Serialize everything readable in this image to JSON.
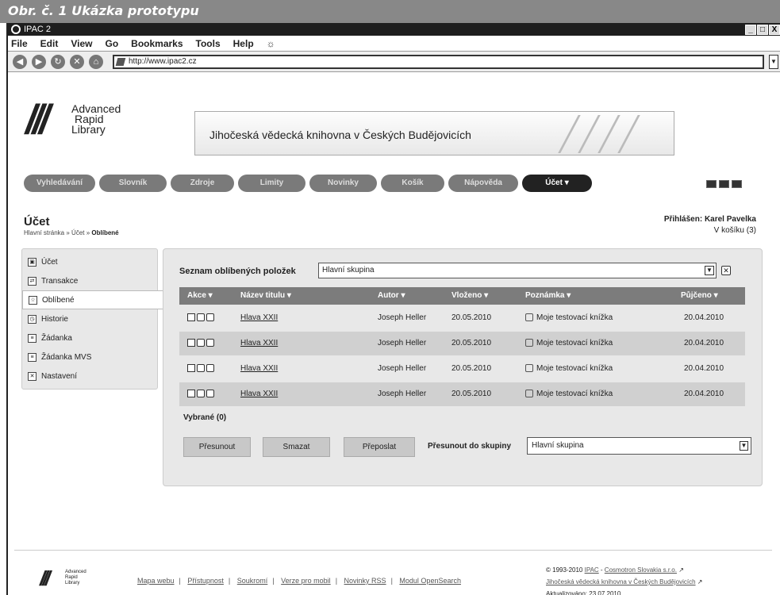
{
  "figure_caption": "Obr. č. 1  Ukázka prototypu",
  "window": {
    "title": "IPAC 2",
    "btn_min": "_",
    "btn_max": "□",
    "btn_close": "X"
  },
  "menubar": [
    "File",
    "Edit",
    "View",
    "Go",
    "Bookmarks",
    "Tools",
    "Help"
  ],
  "address": "http://www.ipac2.cz",
  "logo": {
    "line1": "Advanced",
    "line2": "Rapid",
    "line3": "Library"
  },
  "banner_text": "Jihočeská vědecká knihovna v Českých Budějovicích",
  "tabs": [
    {
      "label": "Vyhledávání",
      "active": false
    },
    {
      "label": "Slovník",
      "active": false
    },
    {
      "label": "Zdroje",
      "active": false
    },
    {
      "label": "Limity",
      "active": false
    },
    {
      "label": "Novinky",
      "active": false
    },
    {
      "label": "Košík",
      "active": false
    },
    {
      "label": "Nápověda",
      "active": false
    },
    {
      "label": "Účet ▾",
      "active": true
    }
  ],
  "heading": "Účet",
  "breadcrumb": {
    "home": "Hlavní stránka",
    "sep": " » ",
    "level2": "Účet",
    "current": "Oblíbené"
  },
  "login": {
    "text": "Přihlášen: Karel Pavelka",
    "basket": "V košíku (3)"
  },
  "sidebar": [
    {
      "label": "Účet",
      "icon": "▣"
    },
    {
      "label": "Transakce",
      "icon": "⇄"
    },
    {
      "label": "Oblíbené",
      "icon": "☆"
    },
    {
      "label": "Historie",
      "icon": "◷"
    },
    {
      "label": "Žádanka",
      "icon": "≡"
    },
    {
      "label": "Žádanka MVS",
      "icon": "≡"
    },
    {
      "label": "Nastavení",
      "icon": "✕"
    }
  ],
  "favorites": {
    "list_label": "Seznam oblíbených položek",
    "group_value": "Hlavní skupina",
    "columns": [
      "Akce ▾",
      "Název titulu ▾",
      "Autor ▾",
      "Vloženo ▾",
      "Poznámka ▾",
      "Půjčeno ▾"
    ],
    "rows": [
      {
        "title": "Hlava XXII",
        "author": "Joseph Heller",
        "added": "20.05.2010",
        "note": "Moje testovací knížka",
        "borrowed": "20.04.2010"
      },
      {
        "title": "Hlava XXII",
        "author": "Joseph Heller",
        "added": "20.05.2010",
        "note": "Moje testovací knížka",
        "borrowed": "20.04.2010"
      },
      {
        "title": "Hlava XXII",
        "author": "Joseph Heller",
        "added": "20.05.2010",
        "note": "Moje testovací knížka",
        "borrowed": "20.04.2010"
      },
      {
        "title": "Hlava XXII",
        "author": "Joseph Heller",
        "added": "20.05.2010",
        "note": "Moje testovací knížka",
        "borrowed": "20.04.2010"
      }
    ],
    "selected_label": "Vybrané (0)",
    "btn_move": "Přesunout",
    "btn_delete": "Smazat",
    "btn_forward": "Přeposlat",
    "move_to_label": "Přesunout do skupiny",
    "move_to_value": "Hlavní skupina"
  },
  "footer": {
    "links": [
      "Mapa webu",
      "Přístupnost",
      "Soukromí",
      "Verze pro mobil",
      "Novinky RSS",
      "Modul OpenSearch"
    ],
    "copyright_prefix": "© 1993-2010",
    "ipac": "IPAC",
    "sep": " - ",
    "cosmotron": "Cosmotron Slovakia s.r.o.",
    "library_link": "Jihočeská vědecká knihovna v Českých Budějovicích",
    "updated": "Aktualizováno: 23.07.2010"
  }
}
